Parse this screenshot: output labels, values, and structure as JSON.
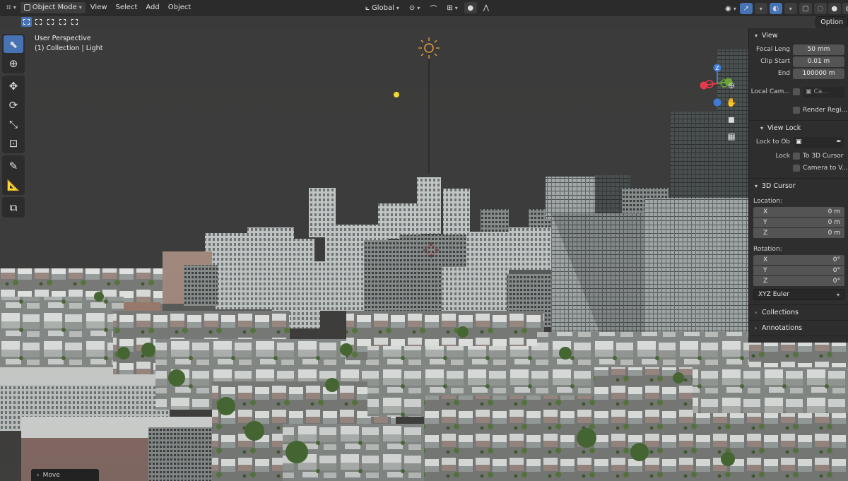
{
  "header": {
    "editor_icon": "viewport-icon",
    "mode": "Object Mode",
    "menus": [
      "View",
      "Select",
      "Add",
      "Object"
    ],
    "transform_orientation": "Global",
    "options_label": "Option"
  },
  "viewport": {
    "perspective": "User Perspective",
    "collection": "(1) Collection | Light"
  },
  "gizmo": {
    "z": "Z"
  },
  "npanel": {
    "view": {
      "title": "View",
      "focal_label": "Focal Leng",
      "focal_value": "50 mm",
      "clip_start_label": "Clip Start",
      "clip_start_value": "0.01 m",
      "end_label": "End",
      "end_value": "100000 m",
      "local_camera_label": "Local Cam...",
      "local_camera_value": "Ca...",
      "render_region_label": "Render Regi..."
    },
    "view_lock": {
      "title": "View Lock",
      "lock_to_obj_label": "Lock to Ob",
      "lock_label": "Lock",
      "to_cursor_label": "To 3D Cursor",
      "camera_to_view_label": "Camera to V..."
    },
    "cursor": {
      "title": "3D Cursor",
      "location_label": "Location:",
      "location": [
        {
          "axis": "X",
          "value": "0 m"
        },
        {
          "axis": "Y",
          "value": "0 m"
        },
        {
          "axis": "Z",
          "value": "0 m"
        }
      ],
      "rotation_label": "Rotation:",
      "rotation": [
        {
          "axis": "X",
          "value": "0°"
        },
        {
          "axis": "Y",
          "value": "0°"
        },
        {
          "axis": "Z",
          "value": "0°"
        }
      ],
      "rotation_mode": "XYZ Euler"
    },
    "collections_title": "Collections",
    "annotations_title": "Annotations"
  },
  "status": {
    "last_op": "Move"
  },
  "colors": {
    "accent": "#4772b3",
    "gizmo_x": "#e53b4a",
    "gizmo_y": "#6aa534",
    "gizmo_z": "#3f7bd6",
    "light": "#e8a03c"
  }
}
